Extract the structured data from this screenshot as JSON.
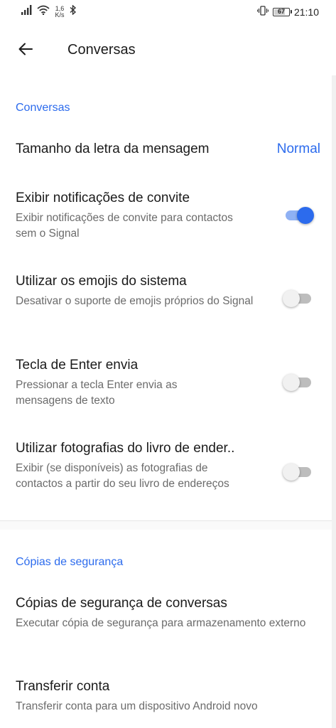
{
  "status_bar": {
    "network_speed_value": "1,6",
    "network_speed_unit": "K/s",
    "battery_level": "67",
    "time": "21:10",
    "icons": [
      "signal-icon",
      "wifi-icon",
      "bluetooth-icon",
      "vibrate-icon",
      "battery-icon"
    ]
  },
  "app_bar": {
    "back_icon": "arrow-left-icon",
    "title": "Conversas"
  },
  "sections": {
    "conversas": {
      "header": "Conversas",
      "font_size": {
        "title": "Tamanho da letra da mensagem",
        "value": "Normal"
      },
      "invite_notifications": {
        "title": "Exibir notificações de convite",
        "summary": "Exibir notificações de convite para contactos sem o Signal",
        "enabled": true
      },
      "system_emoji": {
        "title": "Utilizar os emojis do sistema",
        "summary": "Desativar o suporte de emojis próprios do Signal",
        "enabled": false
      },
      "enter_sends": {
        "title": "Tecla de Enter envia",
        "summary": "Pressionar a tecla Enter envia as mensagens de texto",
        "enabled": false
      },
      "address_book_photos": {
        "title": "Utilizar fotografias do livro de ender..",
        "summary": "Exibir (se disponíveis) as fotografias de contactos a partir do seu livro de endereços",
        "enabled": false
      }
    },
    "backups": {
      "header": "Cópias de segurança",
      "chat_backups": {
        "title": "Cópias de segurança de conversas",
        "summary": "Executar cópia de segurança para armazenamento externo"
      },
      "transfer_account": {
        "title": "Transferir conta",
        "summary": "Transferir conta para um dispositivo Android novo"
      }
    }
  },
  "colors": {
    "accent": "#2c6bed",
    "toggle_on_track": "#8fb1f4",
    "toggle_off_track": "#bdbdbd",
    "summary_text": "#6b6b6b"
  }
}
